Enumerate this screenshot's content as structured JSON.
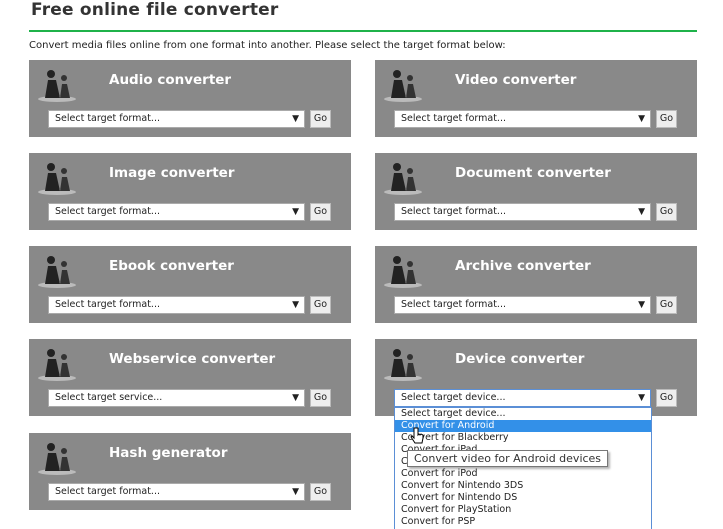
{
  "title": "Free online file converter",
  "intro": "Convert media files online from one format into another. Please select the target format below:",
  "go_label": "Go",
  "panels": [
    {
      "title": "Audio converter",
      "placeholder": "Select target format...",
      "icon": "audio-dancers-icon"
    },
    {
      "title": "Video converter",
      "placeholder": "Select target format...",
      "icon": "video-icon"
    },
    {
      "title": "Image converter",
      "placeholder": "Select target format...",
      "icon": "image-icon"
    },
    {
      "title": "Document converter",
      "placeholder": "Select target format...",
      "icon": "document-icon"
    },
    {
      "title": "Ebook converter",
      "placeholder": "Select target format...",
      "icon": "ebook-icon"
    },
    {
      "title": "Archive converter",
      "placeholder": "Select target format...",
      "icon": "archive-icon"
    },
    {
      "title": "Webservice converter",
      "placeholder": "Select target service...",
      "icon": "webservice-icon"
    },
    {
      "title": "Device converter",
      "placeholder": "Select target device...",
      "icon": "device-icon"
    },
    {
      "title": "Hash generator",
      "placeholder": "Select target format...",
      "icon": "hash-icon"
    }
  ],
  "device_dropdown": {
    "options": [
      "Select target device...",
      "Convert for Android",
      "Convert for Blackberry",
      "Convert for iPad",
      "Convert for iPhone",
      "Convert for iPod",
      "Convert for Nintendo 3DS",
      "Convert for Nintendo DS",
      "Convert for PlayStation",
      "Convert for PSP"
    ],
    "highlighted": "Convert for Android",
    "tooltip": "Convert video for Android devices"
  },
  "colors": {
    "accent": "#1fb24a",
    "panel": "#898989",
    "highlight": "#3390e8"
  }
}
